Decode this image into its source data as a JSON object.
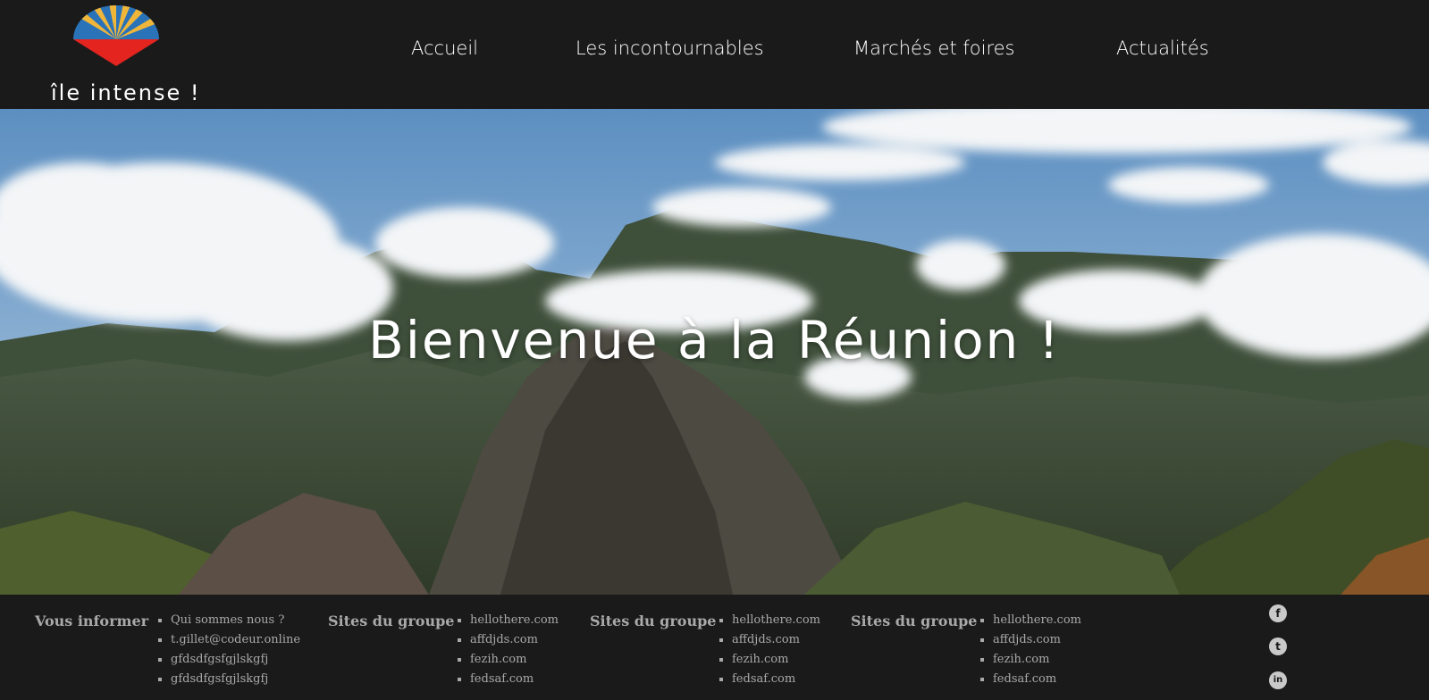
{
  "header": {
    "logo_text": "île intense !",
    "nav": [
      {
        "label": "Accueil"
      },
      {
        "label": "Les incontournables"
      },
      {
        "label": "Marchés et foires"
      },
      {
        "label": "Actualités"
      }
    ]
  },
  "hero": {
    "title": "Bienvenue à la Réunion !"
  },
  "footer": {
    "columns": [
      {
        "heading": "Vous informer",
        "items": [
          "Qui sommes nous ?",
          "t.gillet@codeur.online",
          "gfdsdfgsfgjlskgfj",
          "gfdsdfgsfgjlskgfj"
        ]
      },
      {
        "heading": "Sites du groupe",
        "items": [
          "hellothere.com",
          "affdjds.com",
          "fezih.com",
          "fedsaf.com"
        ]
      },
      {
        "heading": "Sites du groupe",
        "items": [
          "hellothere.com",
          "affdjds.com",
          "fezih.com",
          "fedsaf.com"
        ]
      },
      {
        "heading": "Sites du groupe",
        "items": [
          "hellothere.com",
          "affdjds.com",
          "fezih.com",
          "fedsaf.com"
        ]
      }
    ],
    "social": [
      {
        "icon": "facebook-icon",
        "glyph": "f"
      },
      {
        "icon": "twitter-icon",
        "glyph": "t"
      },
      {
        "icon": "linkedin-icon",
        "glyph": "in"
      }
    ]
  },
  "colors": {
    "background": "#1b1a1b",
    "footer_text": "#a9a9a9",
    "logo_red": "#e3241f",
    "logo_blue": "#2a73b8",
    "logo_yellow": "#f0b63a"
  }
}
